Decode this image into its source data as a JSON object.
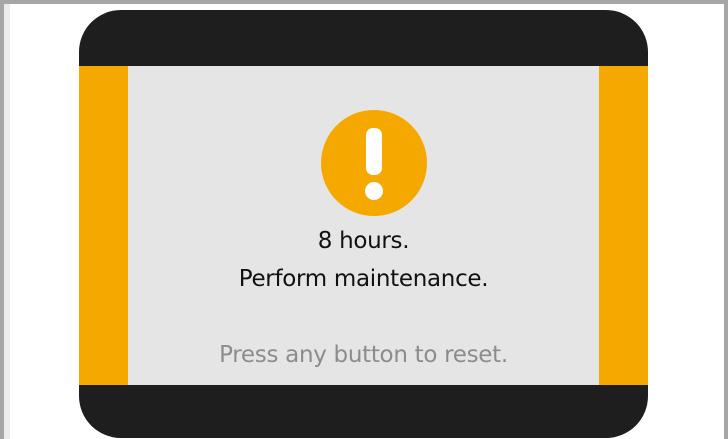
{
  "dialog": {
    "icon": "warning-exclamation-icon",
    "message_line1": "8 hours.",
    "message_line2": "Perform maintenance.",
    "hint": "Press any button to reset."
  },
  "colors": {
    "accent": "#f5a800",
    "bezel": "#1e1e1e",
    "screen_bg": "#e5e5e5",
    "text": "#111111",
    "hint_text": "#8c8c8c",
    "frame_border": "#a6a6a6"
  }
}
